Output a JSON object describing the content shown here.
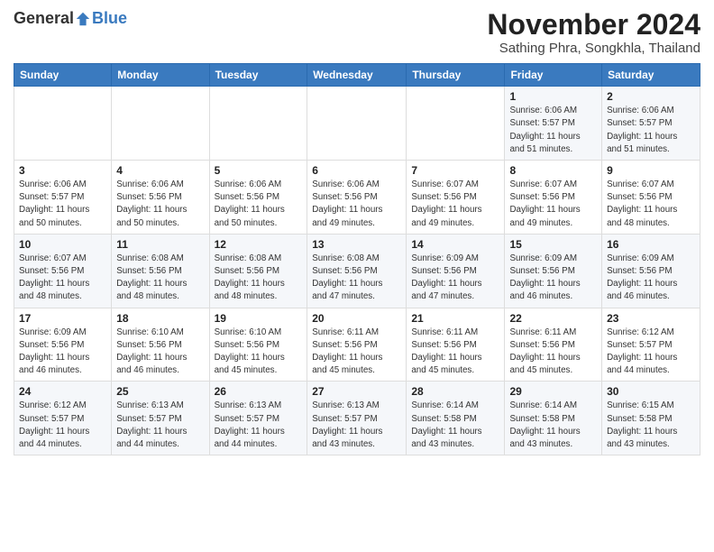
{
  "header": {
    "logo_general": "General",
    "logo_blue": "Blue",
    "month_title": "November 2024",
    "subtitle": "Sathing Phra, Songkhla, Thailand"
  },
  "calendar": {
    "days_of_week": [
      "Sunday",
      "Monday",
      "Tuesday",
      "Wednesday",
      "Thursday",
      "Friday",
      "Saturday"
    ],
    "weeks": [
      [
        {
          "day": "",
          "info": ""
        },
        {
          "day": "",
          "info": ""
        },
        {
          "day": "",
          "info": ""
        },
        {
          "day": "",
          "info": ""
        },
        {
          "day": "",
          "info": ""
        },
        {
          "day": "1",
          "info": "Sunrise: 6:06 AM\nSunset: 5:57 PM\nDaylight: 11 hours\nand 51 minutes."
        },
        {
          "day": "2",
          "info": "Sunrise: 6:06 AM\nSunset: 5:57 PM\nDaylight: 11 hours\nand 51 minutes."
        }
      ],
      [
        {
          "day": "3",
          "info": "Sunrise: 6:06 AM\nSunset: 5:57 PM\nDaylight: 11 hours\nand 50 minutes."
        },
        {
          "day": "4",
          "info": "Sunrise: 6:06 AM\nSunset: 5:56 PM\nDaylight: 11 hours\nand 50 minutes."
        },
        {
          "day": "5",
          "info": "Sunrise: 6:06 AM\nSunset: 5:56 PM\nDaylight: 11 hours\nand 50 minutes."
        },
        {
          "day": "6",
          "info": "Sunrise: 6:06 AM\nSunset: 5:56 PM\nDaylight: 11 hours\nand 49 minutes."
        },
        {
          "day": "7",
          "info": "Sunrise: 6:07 AM\nSunset: 5:56 PM\nDaylight: 11 hours\nand 49 minutes."
        },
        {
          "day": "8",
          "info": "Sunrise: 6:07 AM\nSunset: 5:56 PM\nDaylight: 11 hours\nand 49 minutes."
        },
        {
          "day": "9",
          "info": "Sunrise: 6:07 AM\nSunset: 5:56 PM\nDaylight: 11 hours\nand 48 minutes."
        }
      ],
      [
        {
          "day": "10",
          "info": "Sunrise: 6:07 AM\nSunset: 5:56 PM\nDaylight: 11 hours\nand 48 minutes."
        },
        {
          "day": "11",
          "info": "Sunrise: 6:08 AM\nSunset: 5:56 PM\nDaylight: 11 hours\nand 48 minutes."
        },
        {
          "day": "12",
          "info": "Sunrise: 6:08 AM\nSunset: 5:56 PM\nDaylight: 11 hours\nand 48 minutes."
        },
        {
          "day": "13",
          "info": "Sunrise: 6:08 AM\nSunset: 5:56 PM\nDaylight: 11 hours\nand 47 minutes."
        },
        {
          "day": "14",
          "info": "Sunrise: 6:09 AM\nSunset: 5:56 PM\nDaylight: 11 hours\nand 47 minutes."
        },
        {
          "day": "15",
          "info": "Sunrise: 6:09 AM\nSunset: 5:56 PM\nDaylight: 11 hours\nand 46 minutes."
        },
        {
          "day": "16",
          "info": "Sunrise: 6:09 AM\nSunset: 5:56 PM\nDaylight: 11 hours\nand 46 minutes."
        }
      ],
      [
        {
          "day": "17",
          "info": "Sunrise: 6:09 AM\nSunset: 5:56 PM\nDaylight: 11 hours\nand 46 minutes."
        },
        {
          "day": "18",
          "info": "Sunrise: 6:10 AM\nSunset: 5:56 PM\nDaylight: 11 hours\nand 46 minutes."
        },
        {
          "day": "19",
          "info": "Sunrise: 6:10 AM\nSunset: 5:56 PM\nDaylight: 11 hours\nand 45 minutes."
        },
        {
          "day": "20",
          "info": "Sunrise: 6:11 AM\nSunset: 5:56 PM\nDaylight: 11 hours\nand 45 minutes."
        },
        {
          "day": "21",
          "info": "Sunrise: 6:11 AM\nSunset: 5:56 PM\nDaylight: 11 hours\nand 45 minutes."
        },
        {
          "day": "22",
          "info": "Sunrise: 6:11 AM\nSunset: 5:56 PM\nDaylight: 11 hours\nand 45 minutes."
        },
        {
          "day": "23",
          "info": "Sunrise: 6:12 AM\nSunset: 5:57 PM\nDaylight: 11 hours\nand 44 minutes."
        }
      ],
      [
        {
          "day": "24",
          "info": "Sunrise: 6:12 AM\nSunset: 5:57 PM\nDaylight: 11 hours\nand 44 minutes."
        },
        {
          "day": "25",
          "info": "Sunrise: 6:13 AM\nSunset: 5:57 PM\nDaylight: 11 hours\nand 44 minutes."
        },
        {
          "day": "26",
          "info": "Sunrise: 6:13 AM\nSunset: 5:57 PM\nDaylight: 11 hours\nand 44 minutes."
        },
        {
          "day": "27",
          "info": "Sunrise: 6:13 AM\nSunset: 5:57 PM\nDaylight: 11 hours\nand 43 minutes."
        },
        {
          "day": "28",
          "info": "Sunrise: 6:14 AM\nSunset: 5:58 PM\nDaylight: 11 hours\nand 43 minutes."
        },
        {
          "day": "29",
          "info": "Sunrise: 6:14 AM\nSunset: 5:58 PM\nDaylight: 11 hours\nand 43 minutes."
        },
        {
          "day": "30",
          "info": "Sunrise: 6:15 AM\nSunset: 5:58 PM\nDaylight: 11 hours\nand 43 minutes."
        }
      ]
    ]
  }
}
